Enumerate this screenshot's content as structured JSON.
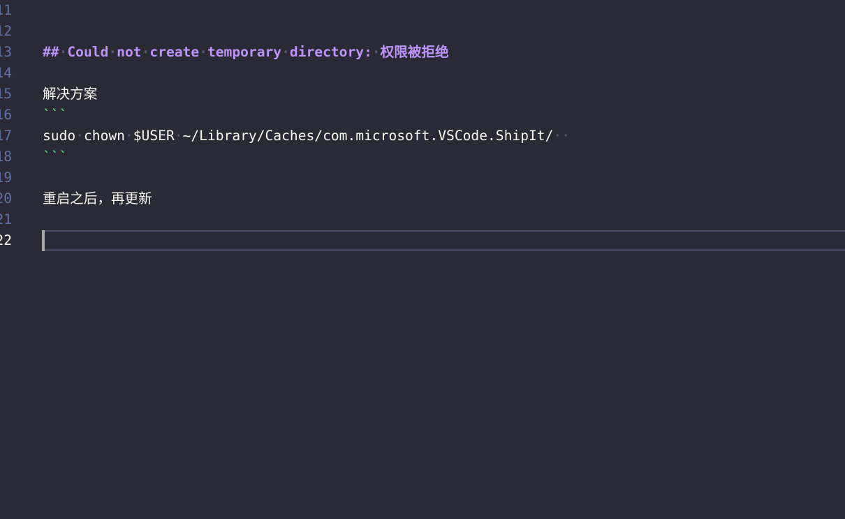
{
  "editor": {
    "line_numbers": [
      "11",
      "12",
      "13",
      "14",
      "15",
      "16",
      "17",
      "18",
      "19",
      "20",
      "21",
      "22"
    ],
    "active_line": "22",
    "lines": {
      "l13": "## Could not create temporary directory: 权限被拒绝",
      "l15": "解决方案",
      "l16": "```",
      "l17": "sudo chown $USER ~/Library/Caches/com.microsoft.VSCode.ShipIt/  ",
      "l18": "```",
      "l20": "重启之后，再更新"
    },
    "colors": {
      "background": "#292a36",
      "heading": "#bd93f9",
      "fence": "#50fa7b",
      "text": "#f8f8f2",
      "line_number": "#6272a4"
    }
  }
}
